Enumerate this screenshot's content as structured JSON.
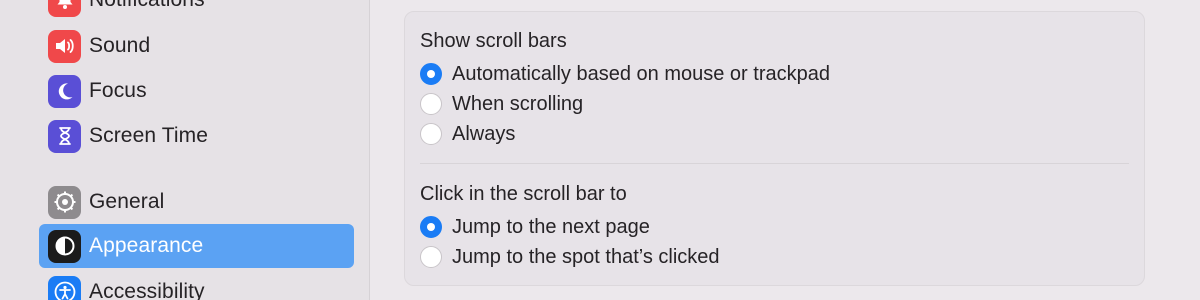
{
  "sidebar": {
    "items": [
      {
        "label": "Notifications",
        "icon": "bell-icon",
        "color": "#f0484a"
      },
      {
        "label": "Sound",
        "icon": "speaker-icon",
        "color": "#f0484a"
      },
      {
        "label": "Focus",
        "icon": "moon-icon",
        "color": "#5a4fd6"
      },
      {
        "label": "Screen Time",
        "icon": "hourglass-icon",
        "color": "#5a4fd6"
      },
      {
        "label": "General",
        "icon": "gear-icon",
        "color": "#8e8b8e"
      },
      {
        "label": "Appearance",
        "icon": "appearance-icon",
        "color": "#1b1b1b",
        "selected": true
      },
      {
        "label": "Accessibility",
        "icon": "accessibility-icon",
        "color": "#1a7cf5"
      }
    ]
  },
  "scroll_bars": {
    "title": "Show scroll bars",
    "options": [
      {
        "label": "Automatically based on mouse or trackpad",
        "selected": true
      },
      {
        "label": "When scrolling",
        "selected": false
      },
      {
        "label": "Always",
        "selected": false
      }
    ]
  },
  "click_scroll_bar": {
    "title": "Click in the scroll bar to",
    "options": [
      {
        "label": "Jump to the next page",
        "selected": true
      },
      {
        "label": "Jump to the spot that’s clicked",
        "selected": false
      }
    ]
  }
}
